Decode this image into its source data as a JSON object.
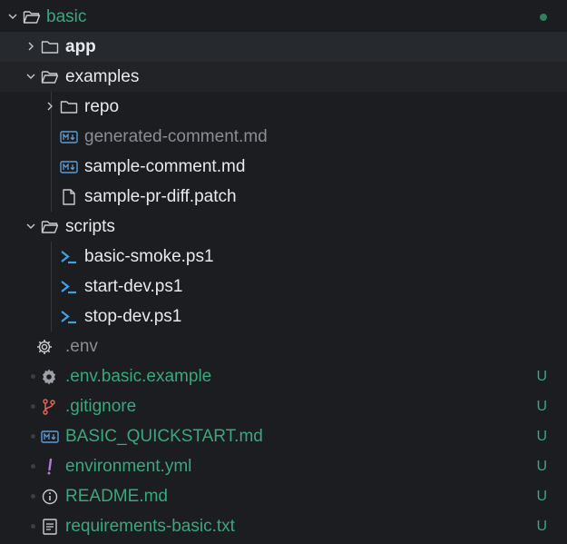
{
  "explorer": {
    "root": {
      "label": "basic"
    },
    "items": [
      {
        "label": "app",
        "icon": "folder-icon",
        "expanded": false
      },
      {
        "label": "examples",
        "icon": "folder-open-icon",
        "expanded": true
      },
      {
        "label": "repo",
        "icon": "folder-icon",
        "expanded": false
      },
      {
        "label": "generated-comment.md",
        "icon": "markdown-icon"
      },
      {
        "label": "sample-comment.md",
        "icon": "markdown-icon"
      },
      {
        "label": "sample-pr-diff.patch",
        "icon": "file-icon"
      },
      {
        "label": "scripts",
        "icon": "folder-open-icon",
        "expanded": true
      },
      {
        "label": "basic-smoke.ps1",
        "icon": "powershell-icon"
      },
      {
        "label": "start-dev.ps1",
        "icon": "powershell-icon"
      },
      {
        "label": "stop-dev.ps1",
        "icon": "powershell-icon"
      },
      {
        "label": ".env",
        "icon": "gear-icon"
      },
      {
        "label": ".env.basic.example",
        "icon": "gear-icon",
        "status": "U"
      },
      {
        "label": ".gitignore",
        "icon": "git-branch-icon",
        "status": "U"
      },
      {
        "label": "BASIC_QUICKSTART.md",
        "icon": "markdown-icon",
        "status": "U"
      },
      {
        "label": "environment.yml",
        "icon": "exclamation-icon",
        "status": "U"
      },
      {
        "label": "README.md",
        "icon": "info-icon",
        "status": "U"
      },
      {
        "label": "requirements-basic.txt",
        "icon": "text-file-icon",
        "status": "U"
      }
    ]
  },
  "colors": {
    "background": "#1b1d21",
    "untracked": "#3aa77e",
    "powershell": "#3aa3e6",
    "markdown": "#5d9bd6",
    "gitignore": "#e0625a",
    "yaml": "#b37ad6"
  }
}
